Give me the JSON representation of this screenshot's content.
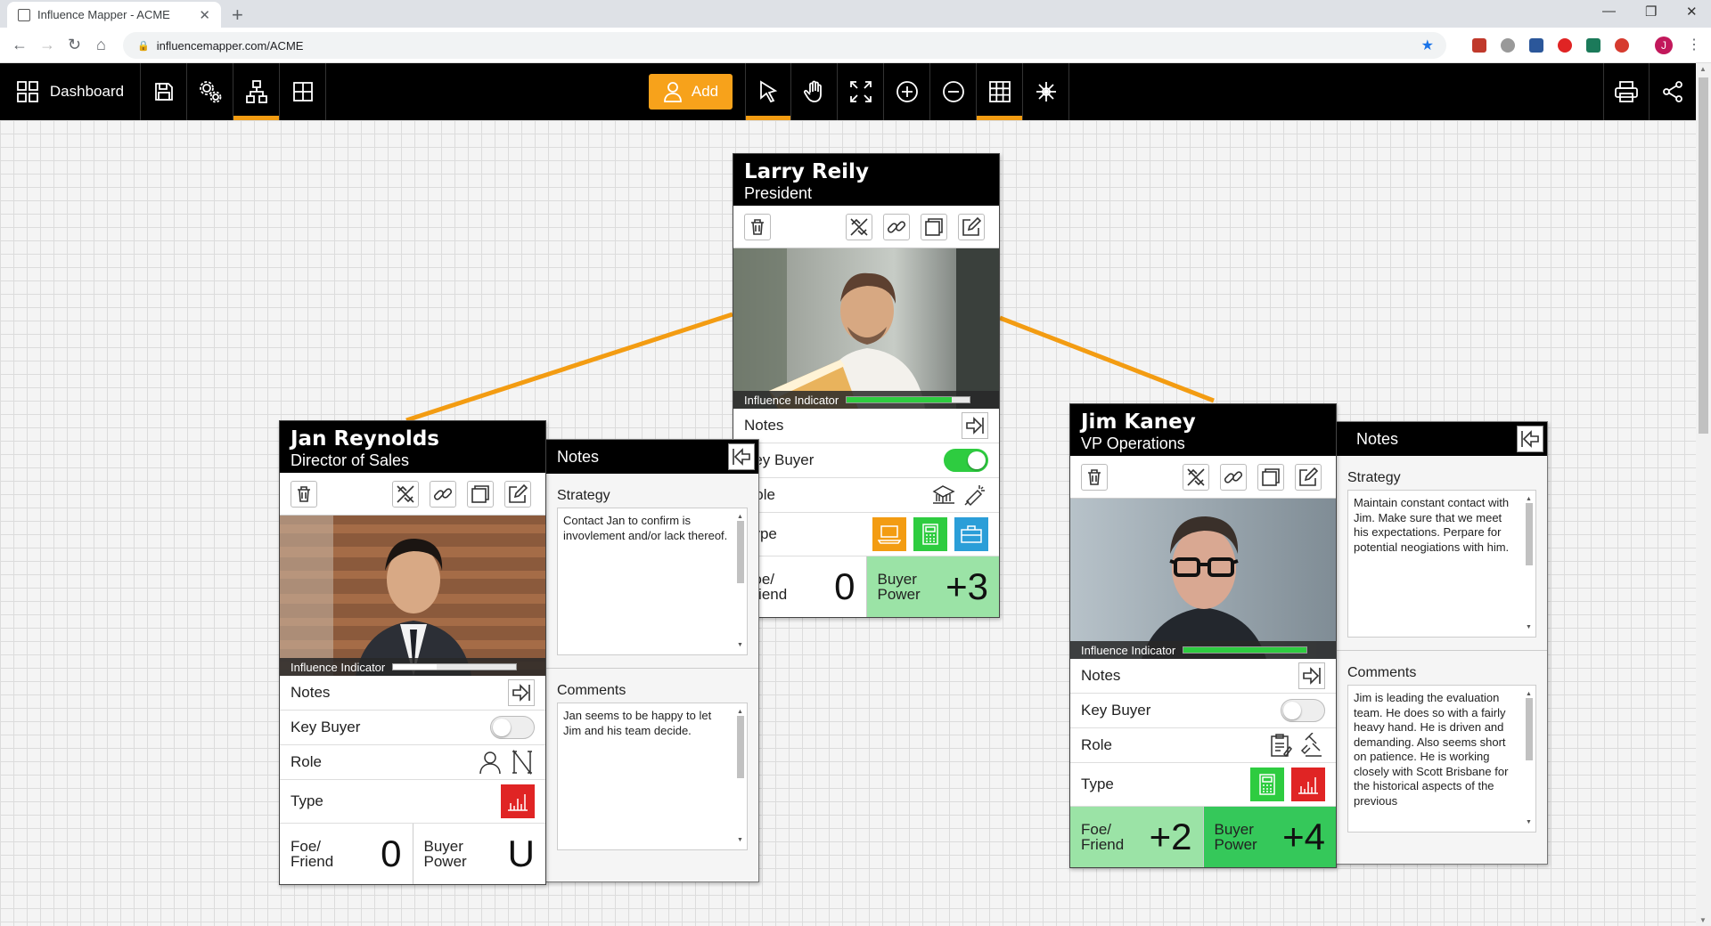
{
  "browser": {
    "tab_title": "Influence Mapper - ACME",
    "url": "influencemapper.com/ACME",
    "profile_initial": "J"
  },
  "toolbar": {
    "dashboard_label": "Dashboard",
    "add_label": "Add",
    "accent_color": "#f7a21b"
  },
  "cards": {
    "larry": {
      "name": "Larry Reily",
      "title": "President",
      "influence_label": "Influence Indicator",
      "influence_level": 0.85,
      "notes_label": "Notes",
      "key_buyer_label": "Key Buyer",
      "key_buyer_on": true,
      "role_label": "Role",
      "type_label": "Type",
      "foe_friend_label": "Foe/ Friend",
      "foe_friend_value": "0",
      "buyer_power_label": "Buyer Power",
      "buyer_power_value": "+3"
    },
    "jan": {
      "name": "Jan Reynolds",
      "title": "Director of Sales",
      "influence_label": "Influence Indicator",
      "influence_level": 0.35,
      "notes_label": "Notes",
      "key_buyer_label": "Key Buyer",
      "key_buyer_on": false,
      "role_label": "Role",
      "type_label": "Type",
      "foe_friend_label": "Foe/ Friend",
      "foe_friend_value": "0",
      "buyer_power_label": "Buyer Power",
      "buyer_power_value": "U"
    },
    "jim": {
      "name": "Jim Kaney",
      "title": "VP Operations",
      "influence_label": "Influence Indicator",
      "influence_level": 1.0,
      "notes_label": "Notes",
      "key_buyer_label": "Key Buyer",
      "key_buyer_on": false,
      "role_label": "Role",
      "type_label": "Type",
      "foe_friend_label": "Foe/ Friend",
      "foe_friend_value": "+2",
      "buyer_power_label": "Buyer Power",
      "buyer_power_value": "+4"
    }
  },
  "notes_panels": {
    "jan": {
      "header": "Notes",
      "strategy_label": "Strategy",
      "strategy_text": "Contact Jan to confirm is invovlement and/or lack thereof.",
      "comments_label": "Comments",
      "comments_text": "Jan seems to be happy to let Jim and his team decide."
    },
    "jim": {
      "header": "Notes",
      "strategy_label": "Strategy",
      "strategy_text": "Maintain constant contact with Jim.  Make sure that we meet his expectations. Perpare for potential neogiations with him.",
      "comments_label": "Comments",
      "comments_text": "Jim is leading the evaluation team.  He does so with a fairly heavy hand.  He is driven and demanding.  Also seems short on patience.  He is working closely with Scott Brisbane for the historical aspects of the previous"
    }
  },
  "colors": {
    "connector": "#f39c12",
    "type_orange": "#f39c12",
    "type_green": "#2ecc40",
    "type_blue": "#2b9ed8",
    "type_red": "#e02424"
  }
}
